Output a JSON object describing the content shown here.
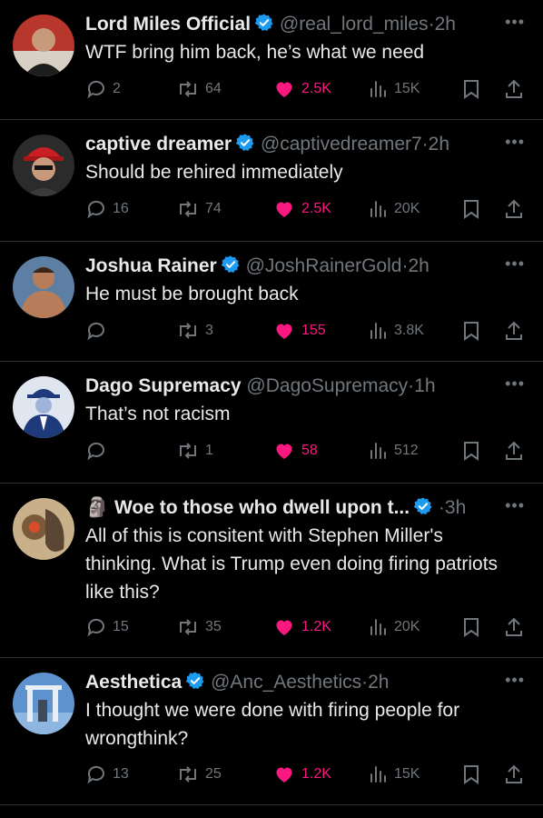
{
  "colors": {
    "background": "#000000",
    "text": "#e7e9ea",
    "muted": "#71767b",
    "like": "#f91880",
    "verified": "#1d9bf0",
    "divider": "#2f3336"
  },
  "icons": {
    "reply": "reply-icon",
    "repost": "repost-icon",
    "like": "heart-icon",
    "views": "views-icon",
    "bookmark": "bookmark-icon",
    "share": "share-icon",
    "more": "more-icon",
    "verified": "verified-badge-icon"
  },
  "tweets": [
    {
      "name": "Lord Miles Official",
      "handle": "@real_lord_miles",
      "time": "2h",
      "verified": true,
      "text": "WTF bring him back, he’s what we need",
      "replies": "2",
      "reposts": "64",
      "likes": "2.5K",
      "views": "15K"
    },
    {
      "name": "captive dreamer",
      "handle": "@captivedreamer7",
      "time": "2h",
      "verified": true,
      "text": "Should be rehired immediately",
      "replies": "16",
      "reposts": "74",
      "likes": "2.5K",
      "views": "20K"
    },
    {
      "name": "Joshua Rainer",
      "handle": "@JoshRainerGold",
      "time": "2h",
      "verified": true,
      "text": "He must be brought back",
      "replies": "",
      "reposts": "3",
      "likes": "155",
      "views": "3.8K"
    },
    {
      "name": "Dago Supremacy",
      "handle": "@DagoSupremacy",
      "time": "1h",
      "verified": false,
      "text": "That’s not racism",
      "replies": "",
      "reposts": "1",
      "likes": "58",
      "views": "512"
    },
    {
      "name": "🗿 Woe to those who dwell upon t...",
      "handle": "",
      "time": "3h",
      "verified": true,
      "text": "All of this is consitent with Stephen Miller's thinking. What is Trump even doing firing patriots like this?",
      "replies": "15",
      "reposts": "35",
      "likes": "1.2K",
      "views": "20K"
    },
    {
      "name": "Aesthetica",
      "handle": "@Anc_Aesthetics",
      "time": "2h",
      "verified": true,
      "text": "I thought we were done with firing people for wrongthink?",
      "replies": "13",
      "reposts": "25",
      "likes": "1.2K",
      "views": "15K"
    }
  ]
}
